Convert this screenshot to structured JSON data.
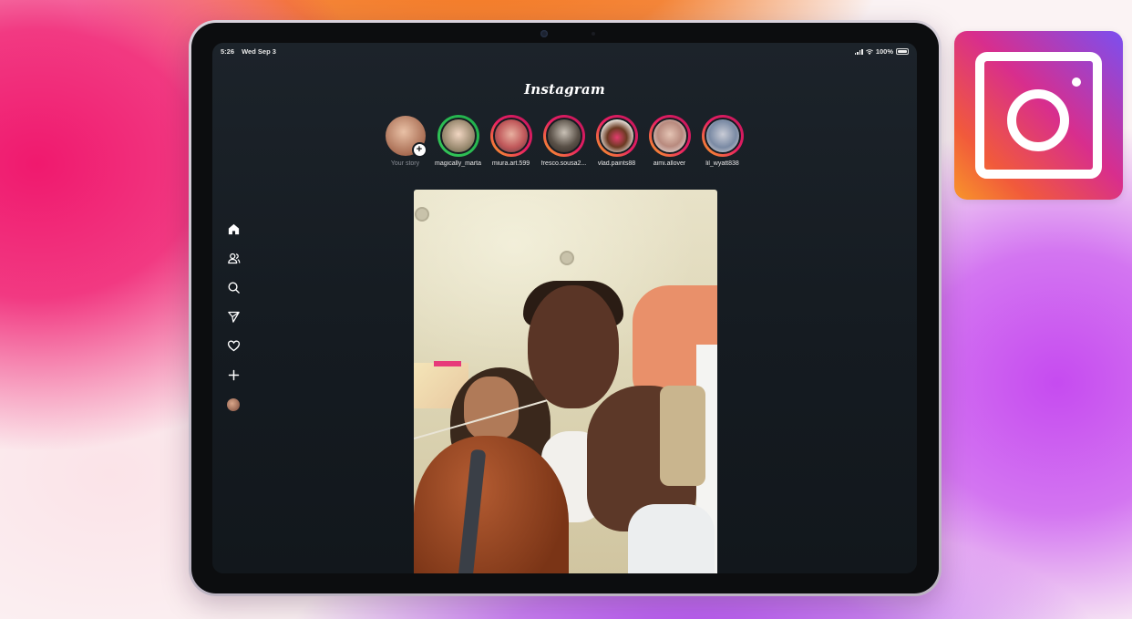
{
  "status_bar": {
    "time": "5:26",
    "date": "Wed Sep 3",
    "battery": "100%"
  },
  "app": {
    "logo": "Instagram"
  },
  "stories": [
    {
      "username": "Your story",
      "own": true
    },
    {
      "username": "magically_marta",
      "ring": "green"
    },
    {
      "username": "miura.art.599",
      "ring": "gradient"
    },
    {
      "username": "fresco.sousa2...",
      "ring": "gradient"
    },
    {
      "username": "vlad.paints88",
      "ring": "gradient"
    },
    {
      "username": "aimi.allover",
      "ring": "gradient"
    },
    {
      "username": "lil_wyatt838",
      "ring": "gradient"
    }
  ],
  "sidebar": [
    {
      "icon": "home-icon"
    },
    {
      "icon": "people-icon"
    },
    {
      "icon": "search-icon"
    },
    {
      "icon": "send-icon"
    },
    {
      "icon": "heart-icon"
    },
    {
      "icon": "plus-icon"
    },
    {
      "icon": "profile-avatar"
    }
  ],
  "colors": {
    "screen_bg": "#151b21",
    "story_ring_green": "#35c759",
    "story_ring_gradient_start": "#f9a825",
    "story_ring_gradient_end": "#c2185b"
  }
}
